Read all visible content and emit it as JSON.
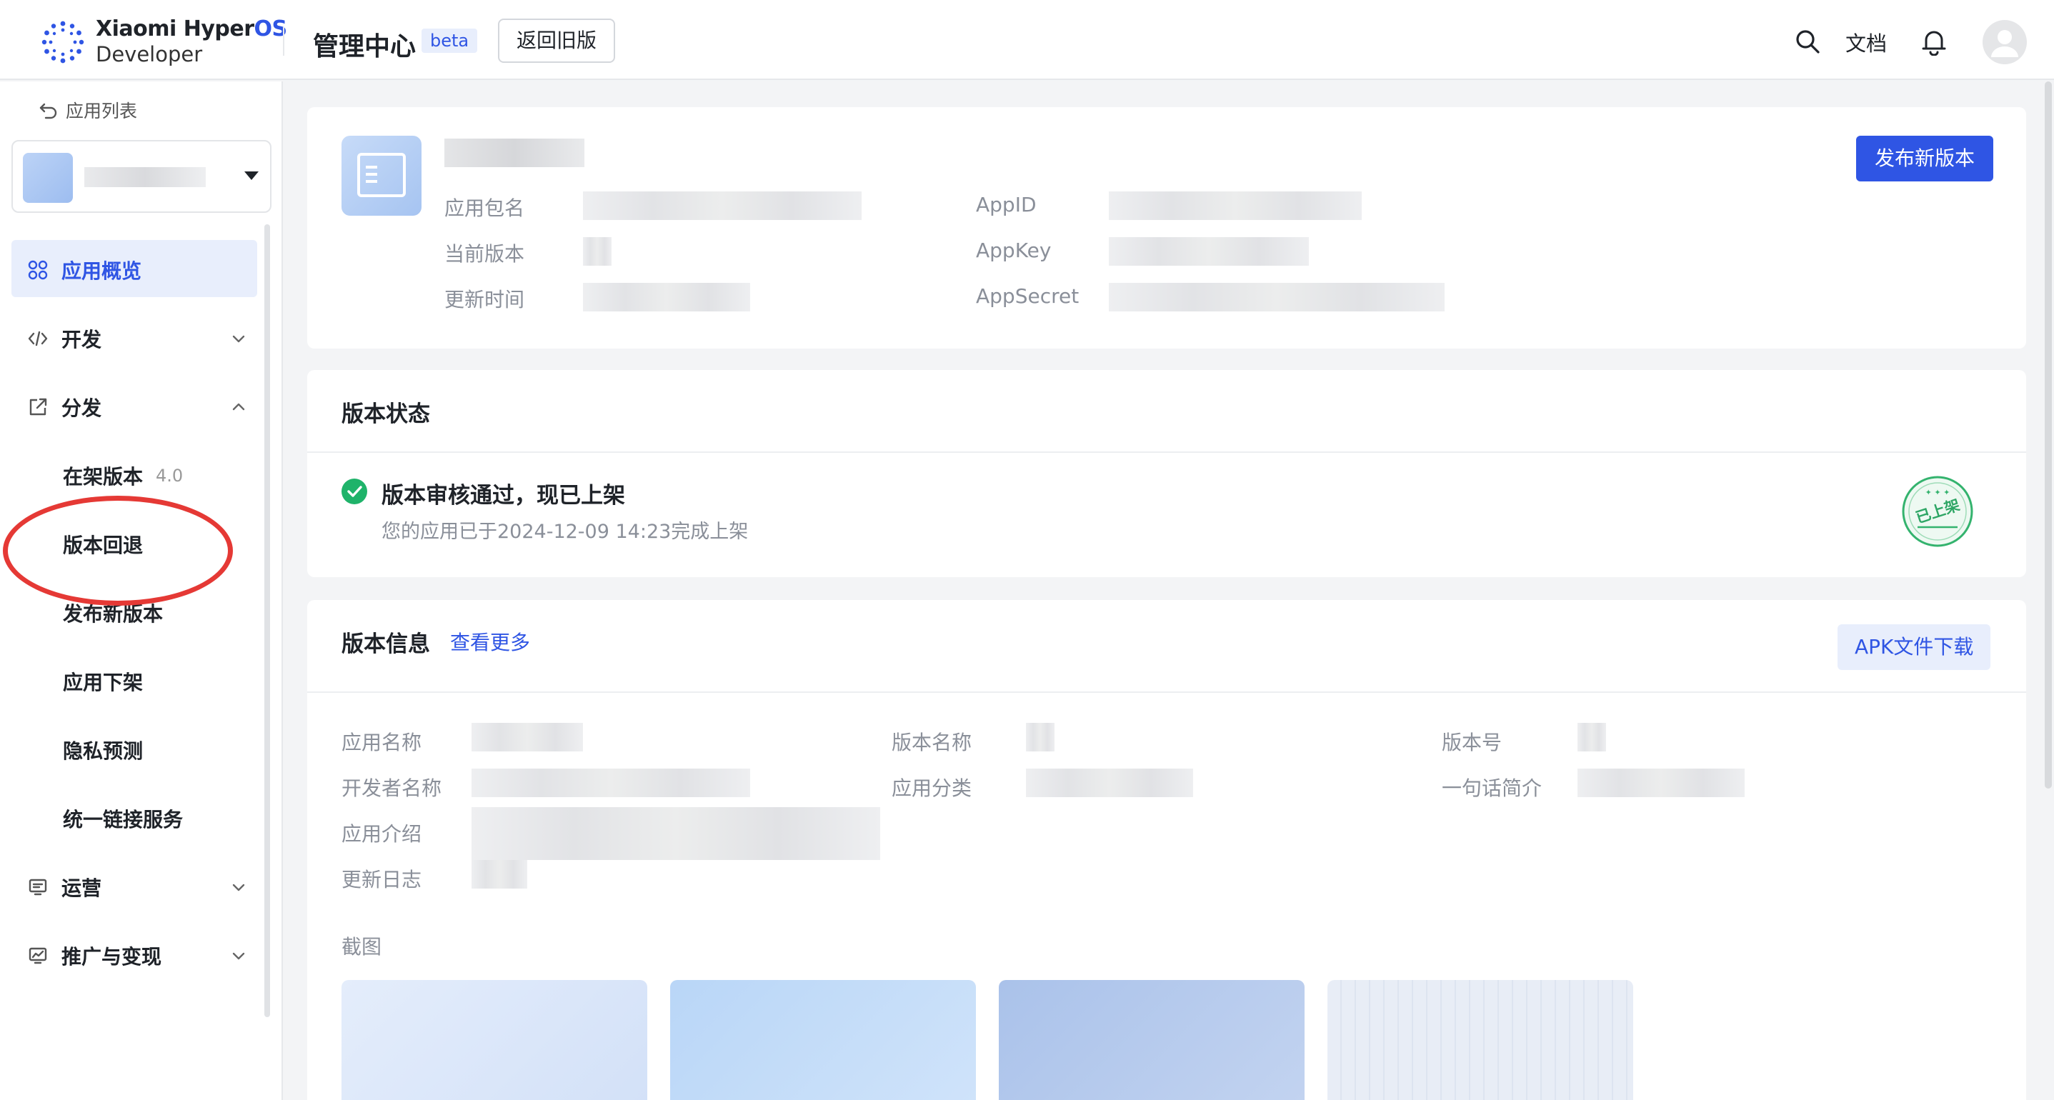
{
  "header": {
    "brand_line1_a": "Xiaomi Hyper",
    "brand_line1_b": "OS",
    "brand_line2": "Developer",
    "title": "管理中心",
    "beta": "beta",
    "old_version_button": "返回旧版",
    "docs_link": "文档"
  },
  "sidebar": {
    "back_link": "应用列表",
    "nav": {
      "overview": "应用概览",
      "develop": "开发",
      "distribute": "分发",
      "distribute_items": [
        {
          "label": "在架版本",
          "badge": "4.0"
        },
        {
          "label": "版本回退"
        },
        {
          "label": "发布新版本"
        },
        {
          "label": "应用下架"
        },
        {
          "label": "隐私预测"
        },
        {
          "label": "统一链接服务"
        }
      ],
      "operations": "运营",
      "promotion": "推广与变现"
    }
  },
  "app_info": {
    "package_label": "应用包名",
    "current_version_label": "当前版本",
    "update_time_label": "更新时间",
    "appid_label": "AppID",
    "appkey_label": "AppKey",
    "appsecret_label": "AppSecret",
    "publish_button": "发布新版本"
  },
  "status_card": {
    "title": "版本状态",
    "status_title": "版本审核通过，现已上架",
    "status_desc": "您的应用已于2024-12-09 14:23完成上架",
    "stamp_text": "已上架"
  },
  "version_card": {
    "title": "版本信息",
    "more_link": "查看更多",
    "apk_button": "APK文件下载",
    "labels": {
      "app_name": "应用名称",
      "developer_name": "开发者名称",
      "app_intro": "应用介绍",
      "changelog": "更新日志",
      "version_name": "版本名称",
      "app_category": "应用分类",
      "version_code": "版本号",
      "tagline": "一句话简介"
    },
    "screenshots_label": "截图"
  },
  "colors": {
    "primary": "#2f55e4",
    "success": "#1fb36a",
    "highlight": "#e53935"
  }
}
